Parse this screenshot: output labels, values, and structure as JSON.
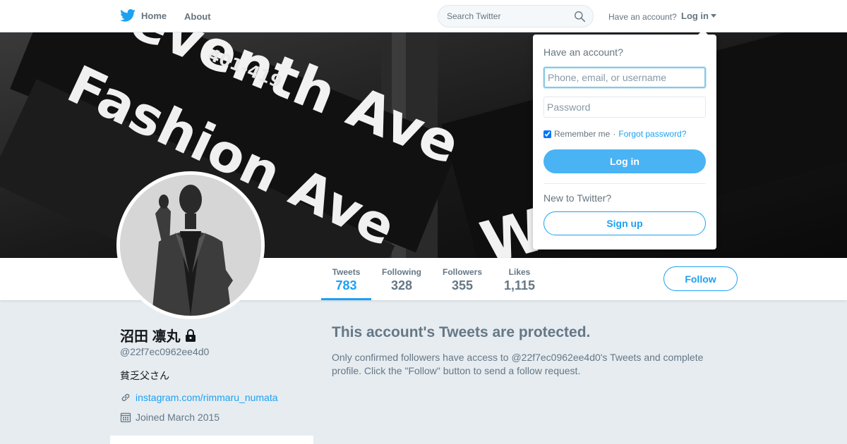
{
  "nav": {
    "home_label": "Home",
    "about_label": "About",
    "search_placeholder": "Search Twitter",
    "have_account": "Have an account?",
    "login_label": "Log in"
  },
  "banner": {
    "sign_texts": [
      "Seventh Ave",
      "Fashion Ave",
      "W St",
      "401-419"
    ]
  },
  "profile": {
    "name": "沼田 凛丸",
    "handle": "@22f7ec0962ee4d0",
    "bio": "貧乏父さん",
    "link": "instagram.com/rimmaru_numata",
    "joined": "Joined March 2015",
    "protected": true
  },
  "stats": [
    {
      "label": "Tweets",
      "value": "783",
      "active": true
    },
    {
      "label": "Following",
      "value": "328",
      "active": false
    },
    {
      "label": "Followers",
      "value": "355",
      "active": false
    },
    {
      "label": "Likes",
      "value": "1,115",
      "active": false
    }
  ],
  "follow_label": "Follow",
  "protected_msg": {
    "title": "This account's Tweets are protected.",
    "text": "Only confirmed followers have access to @22f7ec0962ee4d0's Tweets and complete profile. Click the \"Follow\" button to send a follow request."
  },
  "login_dropdown": {
    "title": "Have an account?",
    "username_placeholder": "Phone, email, or username",
    "password_placeholder": "Password",
    "remember_label": "Remember me",
    "separator": " · ",
    "forgot_label": "Forgot password?",
    "remember_checked": true,
    "login_button": "Log in",
    "new_label": "New to Twitter?",
    "signup_button": "Sign up"
  },
  "colors": {
    "brand": "#1da1f2",
    "background": "#e6ecf0",
    "text_muted": "#657786"
  },
  "icons": [
    "twitter-bird-icon",
    "search-icon",
    "lock-icon",
    "link-icon",
    "calendar-icon",
    "caret-down-icon"
  ]
}
